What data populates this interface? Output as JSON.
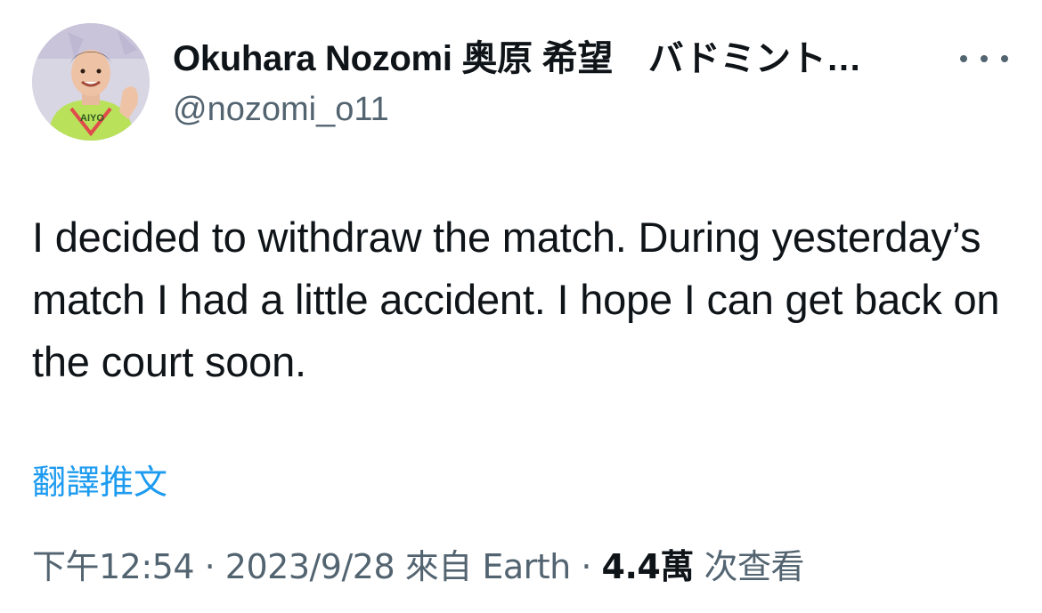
{
  "tweet": {
    "author": {
      "display_name": "Okuhara Nozomi 奥原 希望　バドミント…",
      "handle": "@nozomi_o11",
      "avatar_shirt_text": "AIYO"
    },
    "more_icon": "more-horizontal-icon",
    "text": "I decided to withdraw the match. During yesterday’s match I had a little accident. I hope I can get back on the court soon.",
    "translate_label": "翻譯推文",
    "meta": {
      "time": "下午12:54",
      "separator": "·",
      "date": "2023/9/28",
      "source_prefix": "來自",
      "source": "Earth",
      "views_count": "4.4萬",
      "views_label": "次查看"
    }
  },
  "colors": {
    "text": "#0f1419",
    "secondary": "#536471",
    "link": "#1d9bf0",
    "background": "#ffffff"
  }
}
